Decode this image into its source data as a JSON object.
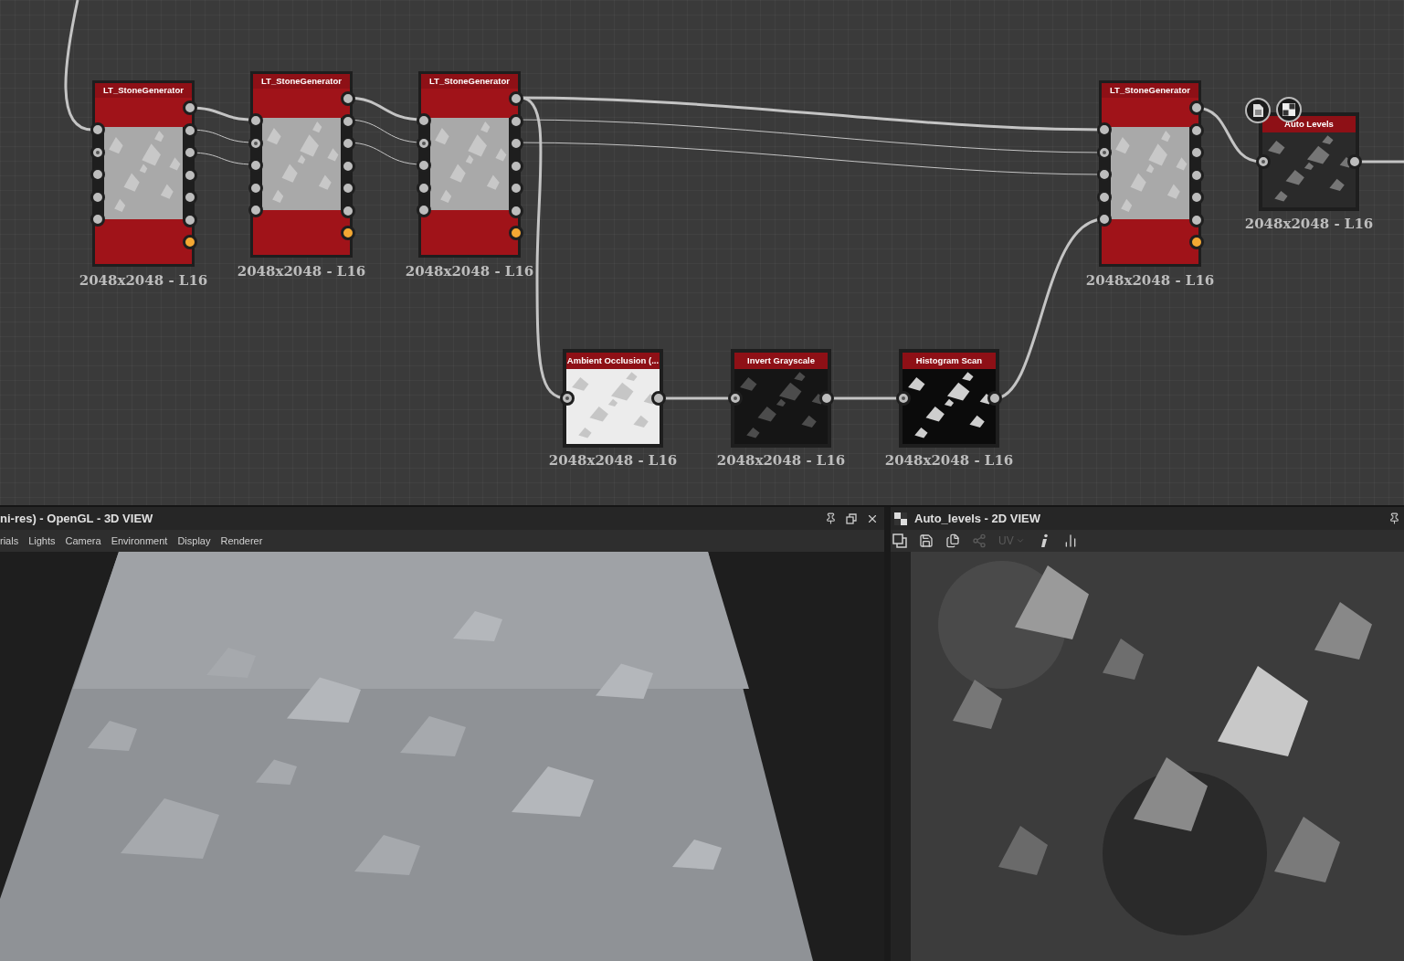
{
  "graph": {
    "nodes": [
      {
        "title": "LT_StoneGenerator",
        "resolution": "2048x2048 - L16",
        "kind": "generator"
      },
      {
        "title": "LT_StoneGenerator",
        "resolution": "2048x2048 - L16",
        "kind": "generator"
      },
      {
        "title": "LT_StoneGenerator",
        "resolution": "2048x2048 - L16",
        "kind": "generator"
      },
      {
        "title": "LT_StoneGenerator",
        "resolution": "2048x2048 - L16",
        "kind": "generator"
      },
      {
        "title": "Auto Levels",
        "resolution": "2048x2048 - L16",
        "kind": "output"
      },
      {
        "title": "Ambient Occlusion (...",
        "resolution": "2048x2048 - L16",
        "kind": "filter"
      },
      {
        "title": "Invert Grayscale",
        "resolution": "2048x2048 - L16",
        "kind": "filter"
      },
      {
        "title": "Histogram Scan",
        "resolution": "2048x2048 - L16",
        "kind": "filter"
      }
    ]
  },
  "view_3d": {
    "title": "ni-res) - OpenGL - 3D VIEW",
    "menu": [
      "rials",
      "Lights",
      "Camera",
      "Environment",
      "Display",
      "Renderer"
    ]
  },
  "view_2d": {
    "title": "Auto_levels - 2D VIEW",
    "toolbar": [
      {
        "kind": "layers",
        "disabled": false
      },
      {
        "kind": "save",
        "disabled": false
      },
      {
        "kind": "copy",
        "disabled": false
      },
      {
        "kind": "share",
        "disabled": true
      },
      {
        "kind": "uv",
        "label": "UV",
        "disabled": true
      },
      {
        "kind": "info",
        "disabled": false
      },
      {
        "kind": "histogram",
        "disabled": false
      }
    ]
  }
}
